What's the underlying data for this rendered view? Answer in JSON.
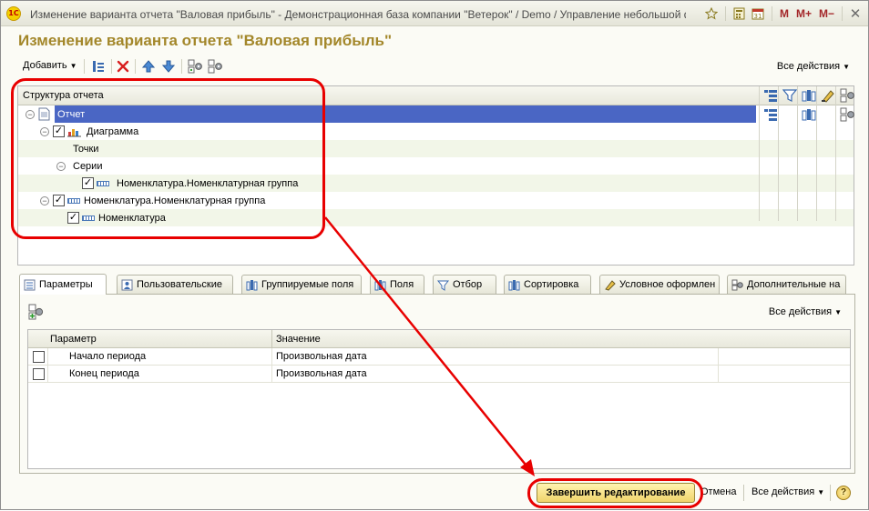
{
  "window": {
    "app_logo_text": "1С",
    "title": "Изменение варианта отчета \"Валовая прибыль\" - Демонстрационная база компании \"Ветерок\" / Demo / Управление небольшой фирмой,...",
    "title_buttons": {
      "m": "M",
      "m_plus": "M+",
      "m_minus": "M−",
      "close": "✕"
    }
  },
  "form": {
    "title": "Изменение варианта отчета \"Валовая прибыль\""
  },
  "toolbar": {
    "add_label": "Добавить",
    "all_actions": "Все действия"
  },
  "structure": {
    "header": "Структура отчета",
    "rows": [
      {
        "label": "Отчет",
        "level": 0,
        "selected": true
      },
      {
        "label": "Диаграмма",
        "level": 1,
        "checked": true
      },
      {
        "label": "Точки",
        "level": 2
      },
      {
        "label": "Серии",
        "level": 2
      },
      {
        "label": "Номенклатура.Номенклатурная группа",
        "level": 3,
        "checked": true
      },
      {
        "label": "Номенклатура.Номенклатурная группа",
        "level": 1,
        "checked": true
      },
      {
        "label": "Номенклатура",
        "level": 2,
        "checked": true
      }
    ]
  },
  "tabs": [
    {
      "label": "Параметры",
      "active": true
    },
    {
      "label": "Пользовательские"
    },
    {
      "label": "Группируемые поля"
    },
    {
      "label": "Поля"
    },
    {
      "label": "Отбор"
    },
    {
      "label": "Сортировка"
    },
    {
      "label": "Условное оформлен"
    },
    {
      "label": "Дополнительные на"
    }
  ],
  "parameters": {
    "all_actions": "Все действия",
    "columns": {
      "param": "Параметр",
      "value": "Значение"
    },
    "rows": [
      {
        "param": "Начало периода",
        "value": "Произвольная дата",
        "checked": false
      },
      {
        "param": "Конец периода",
        "value": "Произвольная дата",
        "checked": false
      }
    ]
  },
  "bottom": {
    "finish_label": "Завершить редактирование",
    "cancel_label": "Отмена",
    "all_actions": "Все действия",
    "help": "?"
  },
  "colors": {
    "title_gold": "#a3872a",
    "selection": "#4a66c4",
    "annotation_red": "#e80000"
  }
}
